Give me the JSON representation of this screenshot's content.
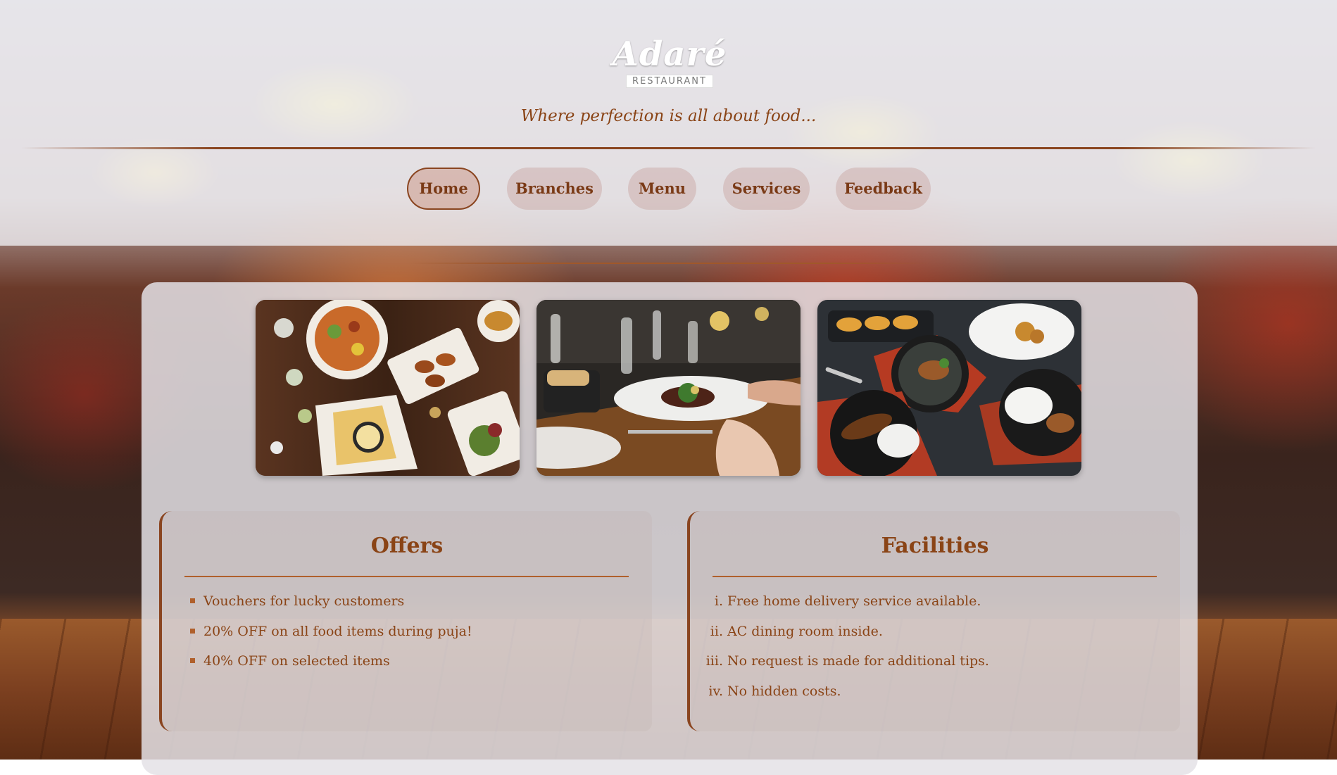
{
  "brand": {
    "name": "Adaré",
    "subtitle": "RESTAURANT",
    "tagline": "Where perfection is all about food..."
  },
  "nav": {
    "items": [
      {
        "label": "Home",
        "active": true
      },
      {
        "label": "Branches",
        "active": false
      },
      {
        "label": "Menu",
        "active": false
      },
      {
        "label": "Services",
        "active": false
      },
      {
        "label": "Feedback",
        "active": false
      }
    ]
  },
  "gallery": [
    {
      "subject": "table-spread-photo"
    },
    {
      "subject": "fine-dining-photo"
    },
    {
      "subject": "plated-dishes-photo"
    }
  ],
  "offers": {
    "title": "Offers",
    "items": [
      "Vouchers for lucky customers",
      "20% OFF on all food items during puja!",
      "40% OFF on selected items"
    ]
  },
  "facilities": {
    "title": "Facilities",
    "numerals": [
      "i.",
      "ii.",
      "iii.",
      "iv."
    ],
    "items": [
      "Free home delivery service available.",
      "AC dining room inside.",
      "No request is made for additional tips.",
      "No hidden costs."
    ]
  },
  "colors": {
    "accent": "#8a4520",
    "text": "#8a4416",
    "header_overlay": "#eeecf0",
    "panel": "#e4e2e6"
  }
}
